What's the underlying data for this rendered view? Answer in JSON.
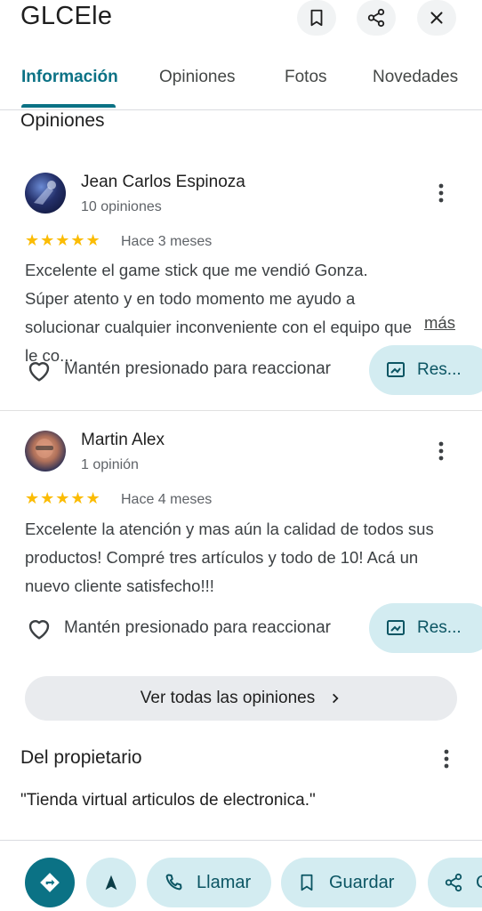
{
  "header": {
    "title": "GLCEle",
    "icons": [
      "bookmark-icon",
      "share-icon",
      "close-icon"
    ]
  },
  "tabs": [
    {
      "label": "Información",
      "active": true
    },
    {
      "label": "Opiniones",
      "active": false
    },
    {
      "label": "Fotos",
      "active": false
    },
    {
      "label": "Novedades",
      "active": false
    }
  ],
  "reviews_section": {
    "title": "Opiniones",
    "reviews": [
      {
        "name": "Jean Carlos Espinoza",
        "count": "10 opiniones",
        "rating": 5,
        "stars": "★★★★★",
        "time": "Hace 3 meses",
        "text": "Excelente el game stick que me vendió Gonza. Súper atento y en todo momento me ayudo a solucionar cualquier inconveniente con el equipo que le co...",
        "more": "más",
        "react_label": "Mantén presionado para reaccionar",
        "reply_label": "Res..."
      },
      {
        "name": "Martin Alex",
        "count": "1 opinión",
        "rating": 5,
        "stars": "★★★★★",
        "time": "Hace 4 meses",
        "text": "Excelente la atención y mas aún la calidad de todos sus productos! Compré tres artículos y todo de 10! Acá un nuevo cliente satisfecho!!!",
        "react_label": "Mantén presionado para reaccionar",
        "reply_label": "Res..."
      }
    ],
    "see_all_label": "Ver todas las opiniones"
  },
  "owner": {
    "title": "Del propietario",
    "description": "\"Tienda virtual articulos de electronica.\""
  },
  "actions": {
    "call_label": "Llamar",
    "save_label": "Guardar",
    "share_label": "C"
  },
  "colors": {
    "accent": "#0b7285",
    "pill_bg": "#d3ecf1",
    "star": "#fbbc04"
  }
}
